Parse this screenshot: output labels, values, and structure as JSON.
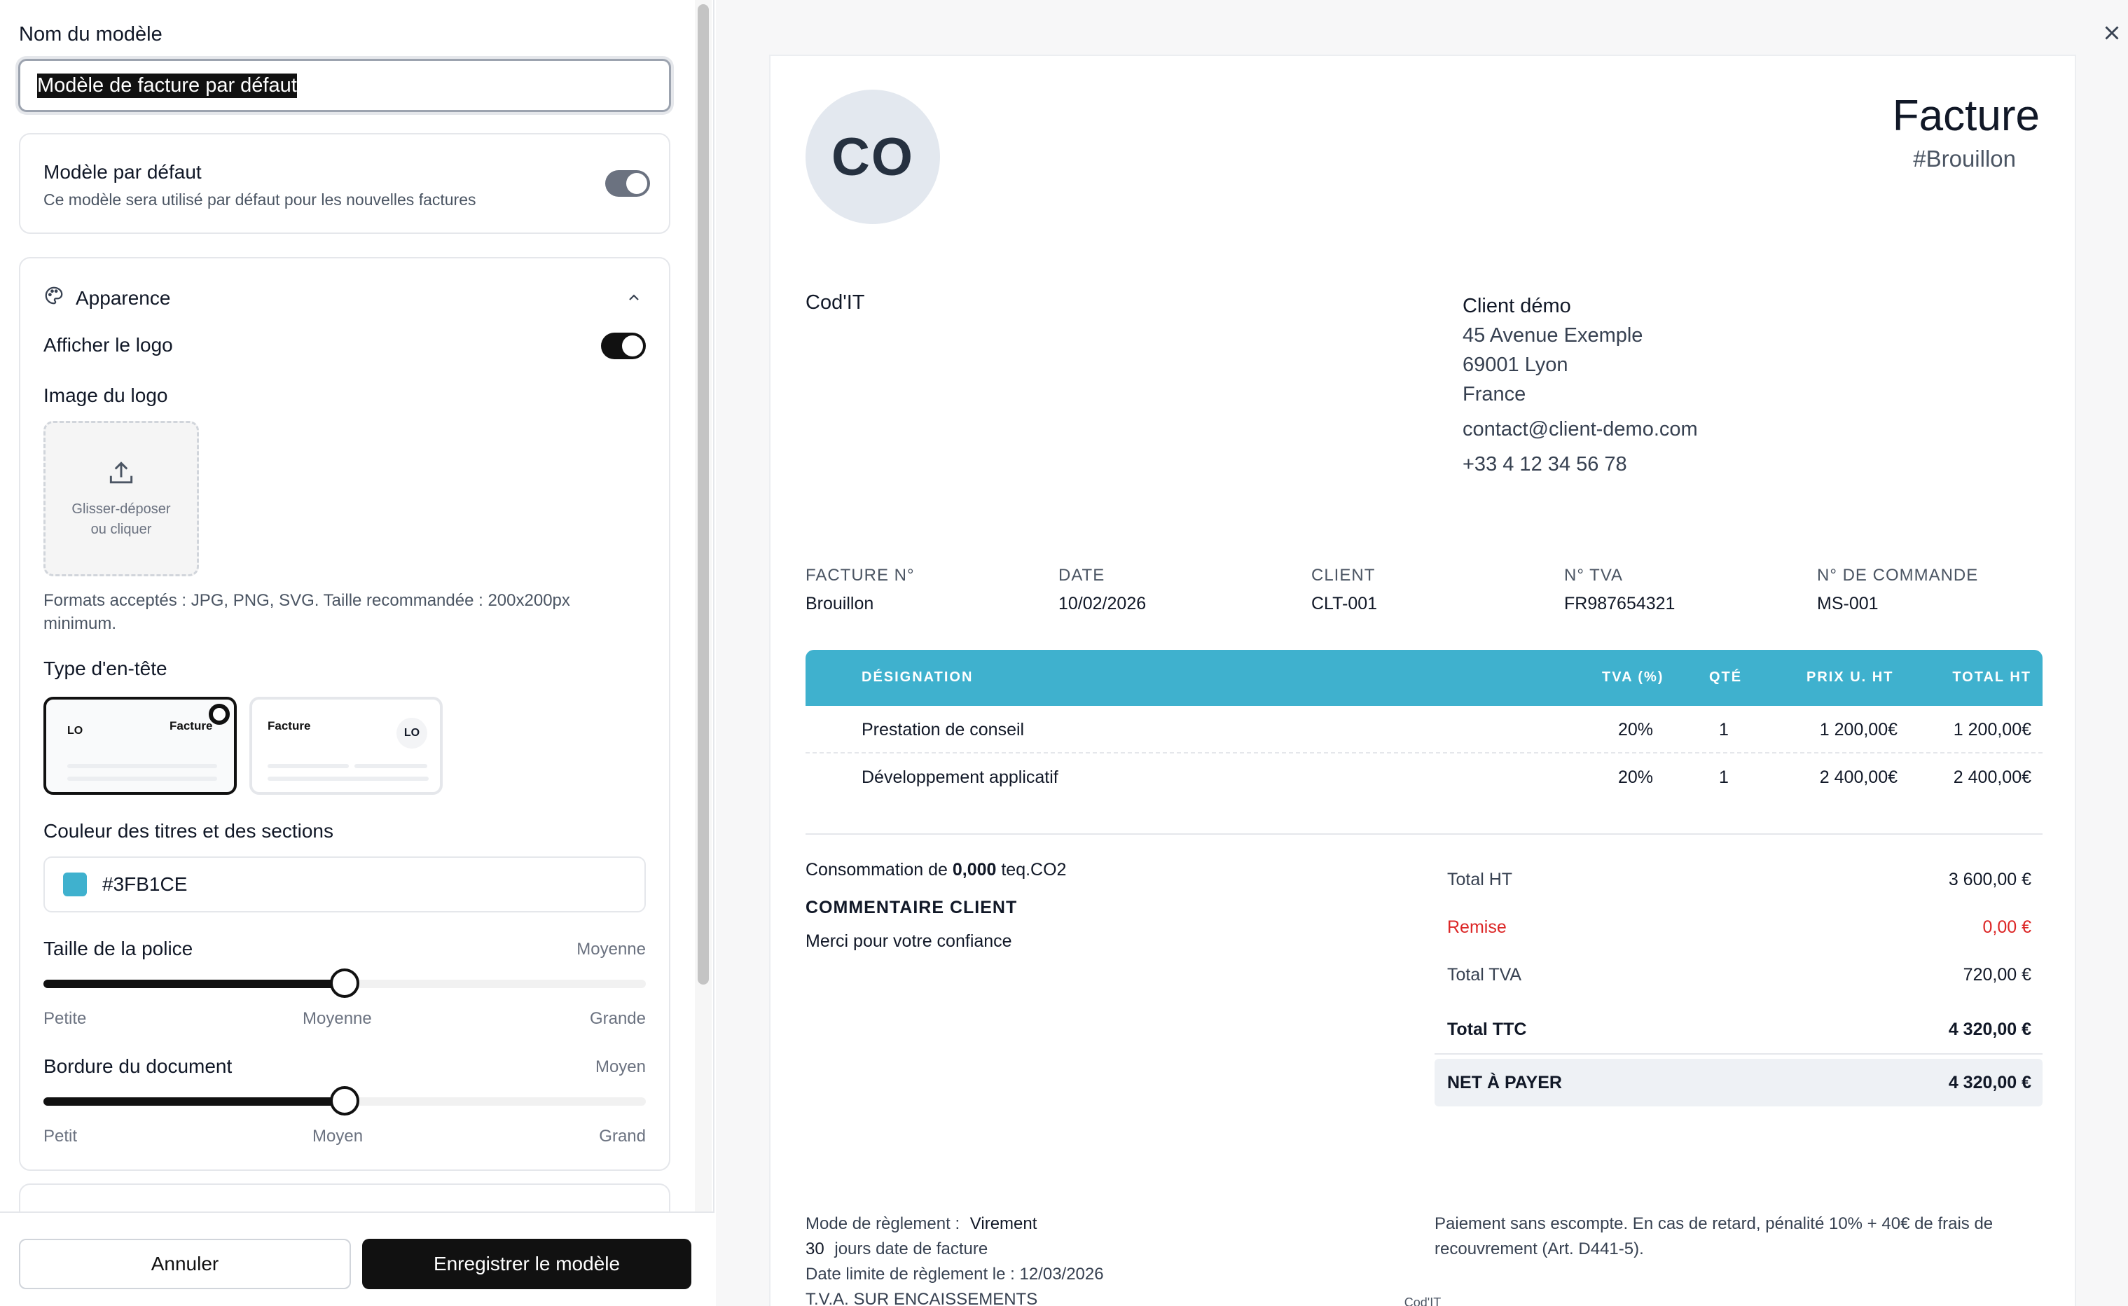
{
  "editor": {
    "name_label": "Nom du modèle",
    "name_value": "Modèle de facture par défaut",
    "default_card": {
      "title": "Modèle par défaut",
      "subtitle": "Ce modèle sera utilisé par défaut pour les nouvelles factures",
      "toggle_on": true
    },
    "appearance": {
      "title": "Apparence",
      "show_logo_label": "Afficher le logo",
      "show_logo_on": true,
      "logo_image_label": "Image du logo",
      "dropzone_line1": "Glisser-déposer",
      "dropzone_line2": "ou cliquer",
      "formats_hint": "Formats acceptés : JPG, PNG, SVG. Taille recommandée : 200x200px minimum.",
      "header_type_label": "Type d'en-tête",
      "header_options": [
        {
          "logo": "LO",
          "title": "Facture",
          "selected": true
        },
        {
          "logo": "LO",
          "title": "Facture",
          "selected": false
        }
      ],
      "title_color_label": "Couleur des titres et des sections",
      "title_color_value": "#3FB1CE",
      "font_size": {
        "label": "Taille de la police",
        "value": "Moyenne",
        "level": 0.5,
        "ticks": [
          "Petite",
          "Moyenne",
          "Grande"
        ]
      },
      "border": {
        "label": "Bordure du document",
        "value": "Moyen",
        "level": 0.5,
        "ticks": [
          "Petit",
          "Moyen",
          "Grand"
        ]
      }
    },
    "cancel_label": "Annuler",
    "save_label": "Enregistrer le modèle"
  },
  "colors": {
    "accent": "#3FB1CE",
    "dark": "#111111",
    "danger": "#DC2626"
  },
  "invoice": {
    "logo_initials": "CO",
    "title": "Facture",
    "number": "#Brouillon",
    "sender": "Cod'IT",
    "client": {
      "name": "Client démo",
      "address1": "45 Avenue Exemple",
      "address2": "69001 Lyon",
      "country": "France",
      "email": "contact@client-demo.com",
      "phone": "+33 4 12 34 56 78"
    },
    "meta": [
      {
        "key": "FACTURE N°",
        "value": "Brouillon"
      },
      {
        "key": "DATE",
        "value": "10/02/2026"
      },
      {
        "key": "CLIENT",
        "value": "CLT-001"
      },
      {
        "key": "N° TVA",
        "value": "FR987654321"
      },
      {
        "key": "N° DE COMMANDE",
        "value": "MS-001"
      }
    ],
    "table": {
      "headers": [
        "DÉSIGNATION",
        "TVA (%)",
        "QTÉ",
        "PRIX U. HT",
        "TOTAL HT"
      ],
      "rows": [
        [
          "Prestation de conseil",
          "20%",
          "1",
          "1 200,00€",
          "1 200,00€"
        ],
        [
          "Développement applicatif",
          "20%",
          "1",
          "2 400,00€",
          "2 400,00€"
        ]
      ]
    },
    "consumption_prefix": "Consommation de",
    "consumption_value": "0,000",
    "consumption_unit": "teq.CO2",
    "comment_title": "COMMENTAIRE CLIENT",
    "comment": "Merci pour votre confiance",
    "totals": {
      "total_ht_label": "Total HT",
      "total_ht": "3 600,00 €",
      "discount_label": "Remise",
      "discount": "0,00 €",
      "total_tva_label": "Total TVA",
      "total_tva": "720,00 €",
      "total_ttc_label": "Total TTC",
      "total_ttc": "4 320,00 €",
      "net_label": "NET À PAYER",
      "net": "4 320,00 €"
    },
    "payment": {
      "mode_label": "Mode de règlement :",
      "mode_value": "Virement",
      "days_value": "30",
      "days_label": "jours date de facture",
      "due_label": "Date limite de règlement le :",
      "due_value": "12/03/2026",
      "vat_note": "T.V.A. SUR ENCAISSEMENTS"
    },
    "terms": "Paiement sans escompte. En cas de retard, pénalité 10% + 40€ de frais de recouvrement (Art. D441-5).",
    "footer": "Cod'IT"
  }
}
